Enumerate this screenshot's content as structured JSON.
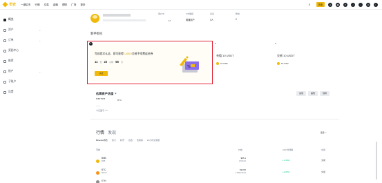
{
  "brand": {
    "name": "币安"
  },
  "nav": [
    "一键买币",
    "行情",
    "交易",
    "金融",
    "理财",
    "广场",
    "更多"
  ],
  "header": {
    "deposit": "充值"
  },
  "sidebar": {
    "items": [
      {
        "label": "概览",
        "active": true,
        "chevron": false
      },
      {
        "label": "资产",
        "active": false,
        "chevron": true
      },
      {
        "label": "订单",
        "active": false,
        "chevron": true
      },
      {
        "label": "奖励中心",
        "active": false,
        "chevron": false
      },
      {
        "label": "推荐",
        "active": false,
        "chevron": false
      },
      {
        "label": "账户",
        "active": false,
        "chevron": true
      },
      {
        "label": "子账户",
        "active": false,
        "chevron": false
      },
      {
        "label": "设置",
        "active": false,
        "chevron": false
      }
    ]
  },
  "profile": {
    "uid_value": "3,8",
    "info": [
      {
        "label": "用户ID",
        "value": ""
      },
      {
        "label": "VIP等级",
        "value": "普通用户"
      },
      {
        "label": "关注",
        "value": "0人"
      },
      {
        "label": "粉丝",
        "value": "0"
      }
    ]
  },
  "newbie": {
    "title": "新手指引",
    "promo": {
      "badge": "1",
      "text_before": "完成首次认证，即可获得",
      "text_highlight": "1,400U",
      "text_after": "交易手续费返还券",
      "days": "11",
      "days_unit": "天",
      "hours": "23",
      "hours_unit": "小时",
      "minutes": "58",
      "minutes_unit": "分",
      "button": "认证"
    },
    "cards": [
      {
        "num": "2",
        "title": "充值 10 USDT",
        "reward": "10 USD"
      },
      {
        "num": "3",
        "title": "交易 10 USDT",
        "reward": "10 USD"
      }
    ]
  },
  "balance": {
    "title": "估算资产估值",
    "masked": "******",
    "unit": "BTC",
    "sub": "——",
    "sub2": "今日盈亏 ****",
    "buttons": [
      "充值",
      "提现",
      "划转"
    ]
  },
  "markets": {
    "tabs": [
      "行情",
      "发现"
    ],
    "more": "更多 >",
    "subtabs": [
      "Binance持仓",
      "热门",
      "新币",
      "自选",
      "涨幅榜",
      "24小时交易量"
    ],
    "headers": {
      "coin": "币种",
      "price": "价格",
      "change": "24小时涨跌",
      "action": "交易"
    },
    "rows": [
      {
        "symbol": "BNB",
        "name": "BNB",
        "price": "$85.1",
        "price2": "¥ 600.10",
        "change": "+1.40%",
        "action": "交易"
      },
      {
        "symbol": "BTC",
        "name": "Bitcoin",
        "price": "53,876",
        "price2": "¥ 380,219.01",
        "change": "+2.60%",
        "action": "交易"
      },
      {
        "symbol": "ETH",
        "name": "Ethereum",
        "price": "",
        "price2": "",
        "change": "",
        "action": ""
      }
    ]
  }
}
